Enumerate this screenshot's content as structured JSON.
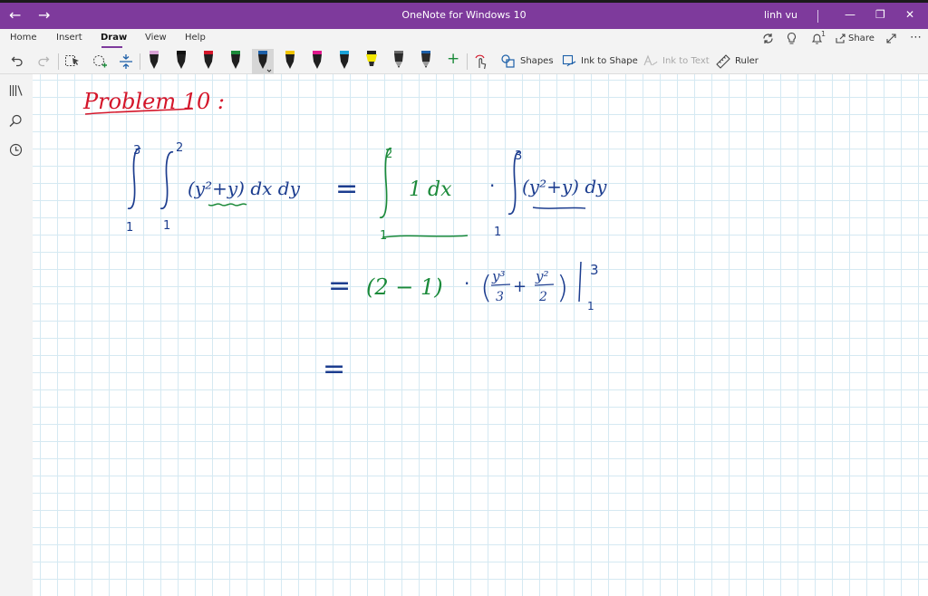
{
  "window": {
    "title": "OneNote for Windows 10",
    "user": "linh vu",
    "back_glyph": "←",
    "forward_glyph": "→",
    "minimize_glyph": "—",
    "restore_glyph": "❐",
    "close_glyph": "✕",
    "title_bar_color": "#7e3a9c"
  },
  "menu": {
    "tabs": [
      "Home",
      "Insert",
      "Draw",
      "View",
      "Help"
    ],
    "active_tab": "Draw",
    "share_label": "Share",
    "notification_count": "1"
  },
  "toolbar": {
    "shapes_label": "Shapes",
    "ink_to_shape_label": "Ink to Shape",
    "ink_to_text_label": "Ink to Text",
    "ruler_label": "Ruler",
    "add_pen_glyph": "+",
    "pens": [
      {
        "color": "#d9a3d6",
        "type": "pen"
      },
      {
        "color": "#111111",
        "type": "pen"
      },
      {
        "color": "#d4162a",
        "type": "pen"
      },
      {
        "color": "#1b8a3a",
        "type": "pen"
      },
      {
        "color": "#1c5fa8",
        "type": "pen",
        "selected": true
      },
      {
        "color": "#f0c400",
        "type": "pen"
      },
      {
        "color": "#e0188c",
        "type": "pen"
      },
      {
        "color": "#1aa3d9",
        "type": "pen"
      },
      {
        "color": "#f2e600",
        "type": "highlighter"
      },
      {
        "color": "#6b6b6b",
        "type": "pencil"
      },
      {
        "color": "#1c5fa8",
        "type": "pencil"
      }
    ]
  },
  "sidebar": {
    "icons": [
      "notebooks-icon",
      "search-icon",
      "recent-icon"
    ]
  },
  "page": {
    "ink_colors": {
      "title": "#d4162a",
      "main": "#1c3d8f",
      "green": "#1b8a3a"
    },
    "heading": "Problem 10 :",
    "line1": {
      "left_outer_upper": "3",
      "left_outer_lower": "1",
      "left_inner_upper": "2",
      "left_inner_lower": "1",
      "left_integrand": "(y²+y) dx dy",
      "equals": "=",
      "first_upper": "2",
      "first_lower": "1",
      "first_integrand": "1 dx",
      "dot": "·",
      "second_upper": "3",
      "second_lower": "1",
      "second_integrand": "(y²+y) dy"
    },
    "line2": {
      "equals": "=",
      "first_factor": "(2 − 1)",
      "dot": "·",
      "cube_num": "y³",
      "cube_den": "3",
      "plus": "+",
      "square_num": "y²",
      "square_den": "2",
      "eval_upper": "3",
      "eval_lower": "1"
    },
    "line3": {
      "equals": "="
    }
  }
}
